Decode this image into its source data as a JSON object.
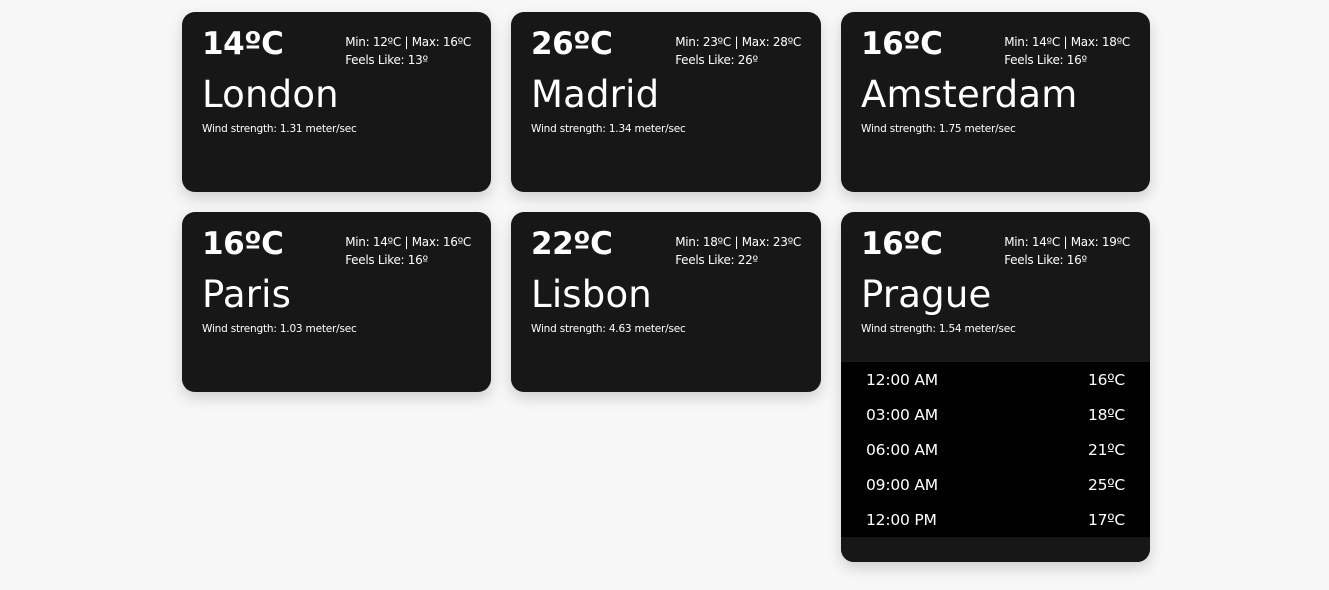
{
  "cards": [
    {
      "temp": "14ºC",
      "min_max": "Min: 12ºC | Max: 16ºC",
      "feels_like": "Feels Like: 13º",
      "city": "London",
      "wind": "Wind strength: 1.31 meter/sec"
    },
    {
      "temp": "26ºC",
      "min_max": "Min: 23ºC | Max: 28ºC",
      "feels_like": "Feels Like: 26º",
      "city": "Madrid",
      "wind": "Wind strength: 1.34 meter/sec"
    },
    {
      "temp": "16ºC",
      "min_max": "Min: 14ºC | Max: 18ºC",
      "feels_like": "Feels Like: 16º",
      "city": "Amsterdam",
      "wind": "Wind strength: 1.75 meter/sec"
    },
    {
      "temp": "16ºC",
      "min_max": "Min: 14ºC | Max: 16ºC",
      "feels_like": "Feels Like: 16º",
      "city": "Paris",
      "wind": "Wind strength: 1.03 meter/sec"
    },
    {
      "temp": "22ºC",
      "min_max": "Min: 18ºC | Max: 23ºC",
      "feels_like": "Feels Like: 22º",
      "city": "Lisbon",
      "wind": "Wind strength: 4.63 meter/sec"
    },
    {
      "temp": "16ºC",
      "min_max": "Min: 14ºC | Max: 19ºC",
      "feels_like": "Feels Like: 16º",
      "city": "Prague",
      "wind": "Wind strength: 1.54 meter/sec",
      "forecast": [
        {
          "time": "12:00 AM",
          "temp": "16ºC"
        },
        {
          "time": "03:00 AM",
          "temp": "18ºC"
        },
        {
          "time": "06:00 AM",
          "temp": "21ºC"
        },
        {
          "time": "09:00 AM",
          "temp": "25ºC"
        },
        {
          "time": "12:00 PM",
          "temp": "17ºC"
        }
      ]
    }
  ],
  "colors": {
    "page_background": "#f7f7f7",
    "card_background": "#171717",
    "forecast_background": "#000000",
    "text": "#ffffff"
  }
}
